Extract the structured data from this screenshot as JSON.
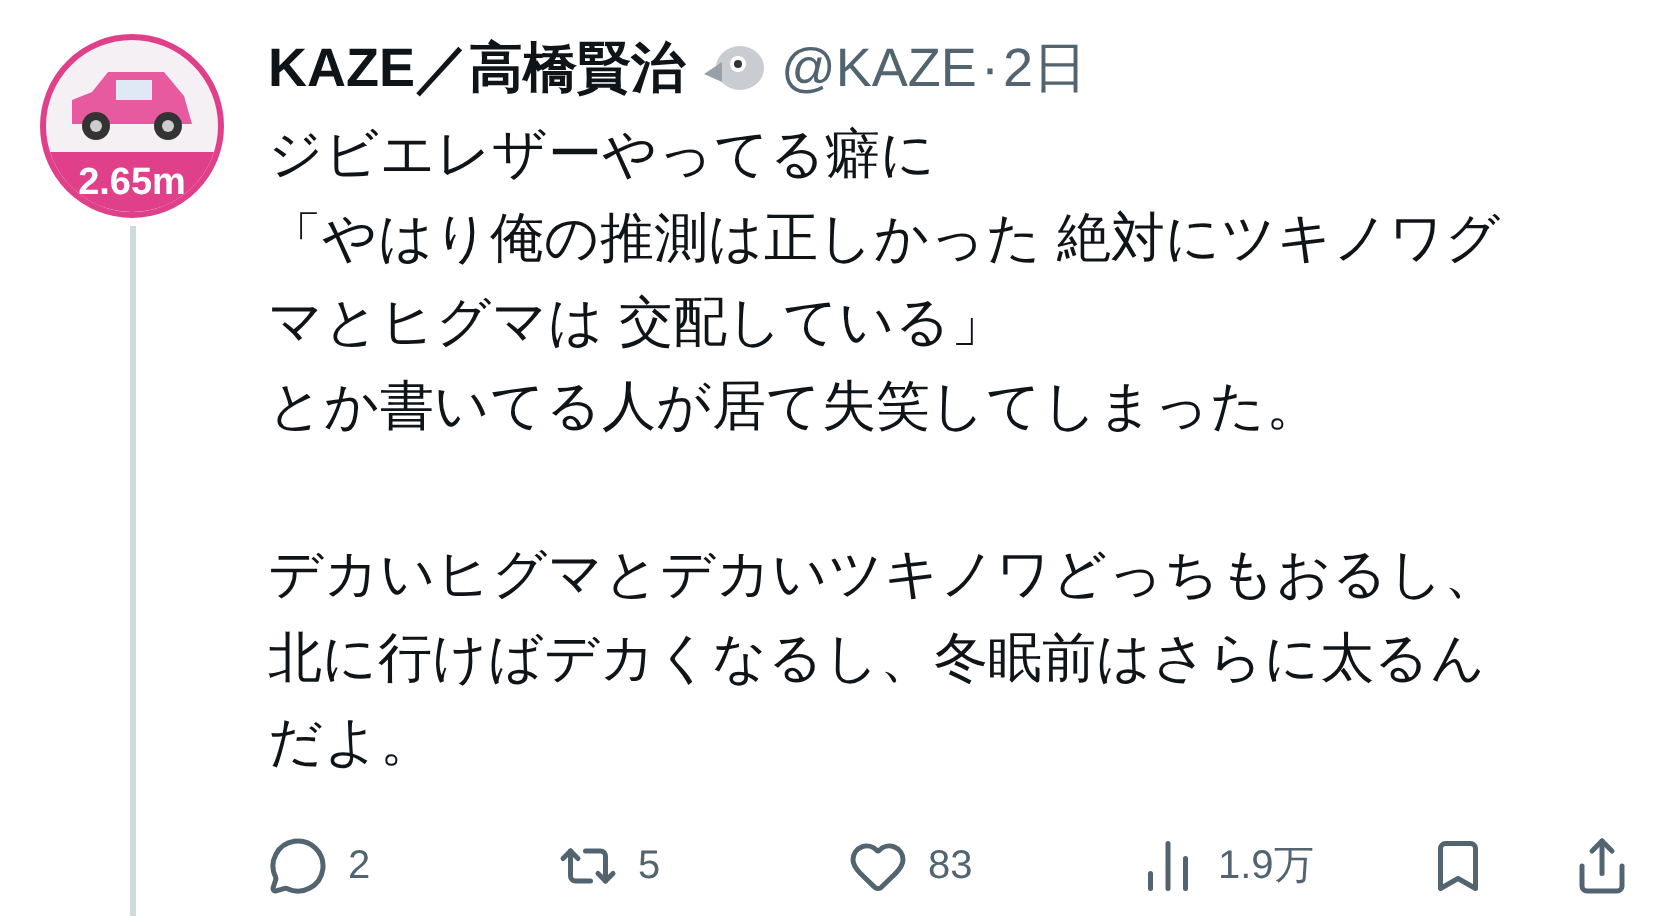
{
  "post": {
    "display_name": "KAZE／高橋賢治",
    "handle": "@KAZE",
    "separator": "·",
    "time": "2日",
    "avatar_badge": "2.65m",
    "paragraphs": [
      [
        "ジビエレザーやってる癖に",
        "「やはり俺の推測は正しかった 絶対にツキノワグ",
        "マとヒグマは 交配している」",
        "とか書いてる人が居て失笑してしまった。"
      ],
      [
        "デカいヒグマとデカいツキノワどっちもおるし、",
        "北に行けばデカくなるし、冬眠前はさらに太るん",
        "だよ。"
      ]
    ],
    "actions": [
      {
        "kind": "reply",
        "count": "2"
      },
      {
        "kind": "repost",
        "count": "5"
      },
      {
        "kind": "like",
        "count": "83"
      },
      {
        "kind": "views",
        "count": "1.9万"
      },
      {
        "kind": "bookmark"
      },
      {
        "kind": "share"
      }
    ]
  }
}
